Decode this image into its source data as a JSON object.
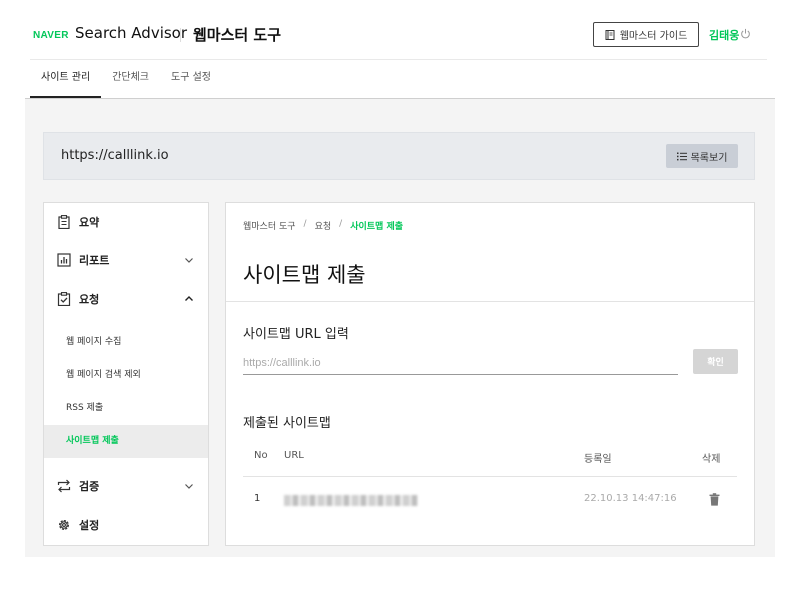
{
  "header": {
    "logo": "NAVER",
    "brand": "Search Advisor",
    "brand_sub": "웹마스터 도구",
    "guide_button": "웹마스터 가이드",
    "user_name": "김태웅"
  },
  "tabs": [
    {
      "label": "사이트 관리",
      "active": true
    },
    {
      "label": "간단체크",
      "active": false
    },
    {
      "label": "도구 설정",
      "active": false
    }
  ],
  "site": {
    "url": "https://calllink.io",
    "list_button": "목록보기"
  },
  "sidebar": {
    "items": [
      {
        "label": "요약"
      },
      {
        "label": "리포트"
      },
      {
        "label": "요청"
      },
      {
        "label": "검증"
      },
      {
        "label": "설정"
      }
    ],
    "sub_items": [
      {
        "label": "웹 페이지 수집",
        "active": false
      },
      {
        "label": "웹 페이지 검색 제외",
        "active": false
      },
      {
        "label": "RSS 제출",
        "active": false
      },
      {
        "label": "사이트맵 제출",
        "active": true
      }
    ]
  },
  "main": {
    "breadcrumb": [
      "웹마스터 도구",
      "요청",
      "사이트맵 제출"
    ],
    "title": "사이트맵 제출",
    "input_section": "사이트맵 URL 입력",
    "input_placeholder": "https://calllink.io",
    "confirm_button": "확인",
    "table_section": "제출된 사이트맵",
    "columns": [
      "No",
      "URL",
      "등록일",
      "삭제"
    ],
    "rows": [
      {
        "no": "1",
        "date": "22.10.13 14:47:16"
      }
    ]
  },
  "colors": {
    "accent": "#03c75a"
  }
}
